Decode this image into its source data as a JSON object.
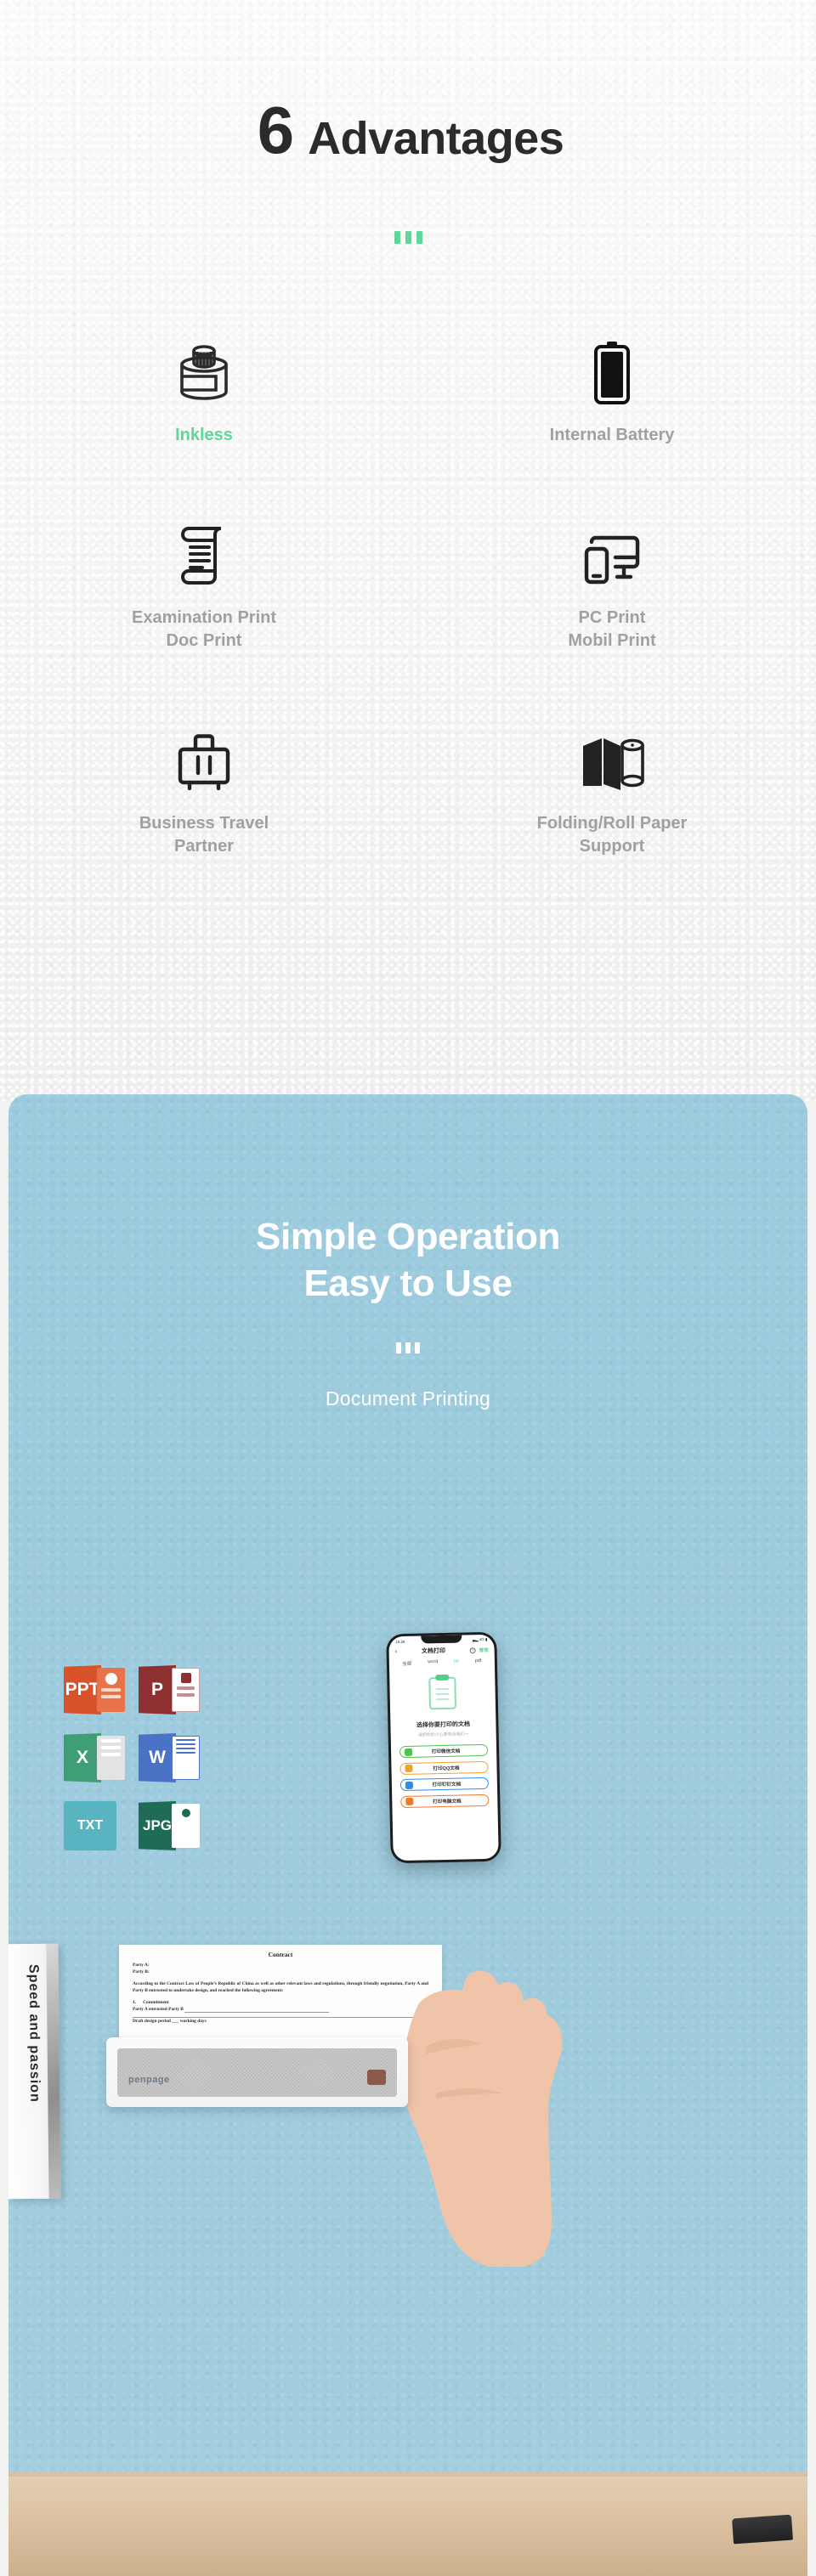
{
  "advantages": {
    "number": "6",
    "title": "Advantages",
    "items": [
      {
        "label": "Inkless",
        "icon": "ink-bottle-icon",
        "accent": true
      },
      {
        "label": "Internal Battery",
        "icon": "battery-icon",
        "accent": false
      },
      {
        "label": "Examination Print\nDoc Print",
        "icon": "document-scroll-icon",
        "accent": false
      },
      {
        "label": "PC Print\nMobil Print",
        "icon": "monitor-phone-icon",
        "accent": false
      },
      {
        "label": "Business Travel\nPartner",
        "icon": "suitcase-icon",
        "accent": false
      },
      {
        "label": "Folding/Roll Paper\nSupport",
        "icon": "folded-roll-paper-icon",
        "accent": false
      }
    ],
    "accent_color": "#5fd79b",
    "underline_color": "#f6a93b"
  },
  "showcase": {
    "headline_line1": "Simple Operation",
    "headline_line2": "Easy to Use",
    "subtitle": "Document Printing",
    "background_color": "#9ecbdd",
    "file_badges": [
      {
        "name": "PPT",
        "icon": "ppt-file-icon",
        "color": "#d8532a"
      },
      {
        "name": "P",
        "icon": "pdf-file-icon",
        "color": "#8e2f30"
      },
      {
        "name": "X",
        "icon": "excel-file-icon",
        "color": "#3f9e75"
      },
      {
        "name": "W",
        "icon": "word-file-icon",
        "color": "#4a73c6"
      },
      {
        "name": "TXT",
        "icon": "txt-file-icon",
        "color": "#57b4c0"
      },
      {
        "name": "JPG",
        "icon": "jpg-file-icon",
        "color": "#1f6b55"
      }
    ]
  },
  "phone": {
    "status": {
      "time": "15:26",
      "right": "▃▂ 4G ▮"
    },
    "nav": {
      "back": "‹",
      "title": "文档打印",
      "help": "?",
      "manage": "管理"
    },
    "tabs": [
      {
        "label": "全部",
        "active": false
      },
      {
        "label": "word",
        "active": false
      },
      {
        "label": "txt",
        "active": true
      },
      {
        "label": "pdf",
        "active": false
      }
    ],
    "empty_title": "选择你要打印的文档",
    "empty_sub": "请把你的小心愿告诉我们～",
    "buttons": [
      {
        "label": "打印微信文档",
        "color": "#4fc24f",
        "icon": "wechat-icon"
      },
      {
        "label": "打印QQ文档",
        "color": "#f0a32a",
        "icon": "qq-icon"
      },
      {
        "label": "打印钉钉文档",
        "color": "#2d8cf0",
        "icon": "dingtalk-icon"
      },
      {
        "label": "打印电脑文档",
        "color": "#ef7b2a",
        "icon": "computer-icon"
      }
    ]
  },
  "contract": {
    "title": "Contract",
    "party_a": "Party A:",
    "party_b": "Party B:",
    "body": "According to the Contract Law of People’s Republic of China as well as other relevant laws and regulations, through friendly negotiation, Party A and Party B entrusted to undertake design, and reached the following agreement:",
    "clause_no": "1.",
    "clause_title": "Commitment",
    "clause_line": "Party A entrusted Party B",
    "period_line": "Draft design period ___ working days"
  },
  "printer": {
    "brand": "penpage"
  },
  "book": {
    "spine_text": "Speed and passion"
  }
}
